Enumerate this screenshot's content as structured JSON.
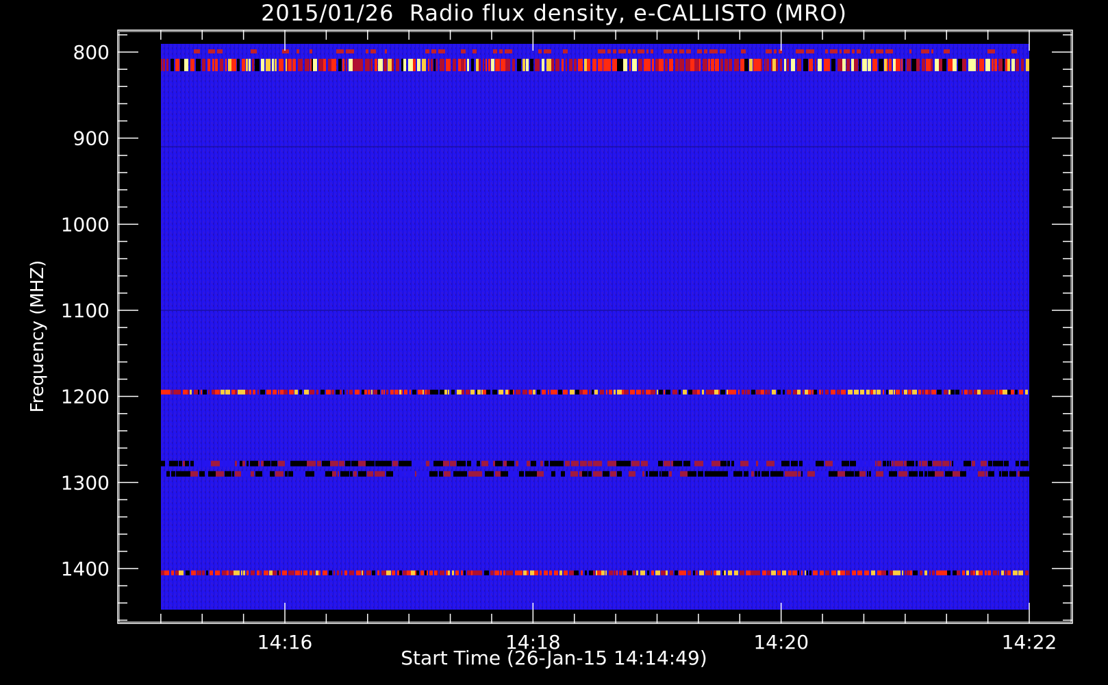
{
  "chart_data": {
    "type": "heatmap",
    "title": "2015/01/26  Radio flux density, e-CALLISTO (MRO)",
    "xlabel": "Start Time (26-Jan-15 14:14:49)",
    "ylabel": "Frequency (MHZ)",
    "x_tick_labels": [
      "14:16",
      "14:18",
      "14:20",
      "14:22"
    ],
    "y_tick_labels": [
      "800",
      "900",
      "1000",
      "1100",
      "1200",
      "1300",
      "1400"
    ],
    "ylim": [
      1450,
      790
    ],
    "y_axis_inverted": true,
    "colormap": "blue-red-yellow",
    "background_color": "#1f12ee",
    "bright_bands_mhz": [
      815,
      1195,
      1405
    ],
    "dark_bands_mhz": [
      1278,
      1290
    ]
  }
}
